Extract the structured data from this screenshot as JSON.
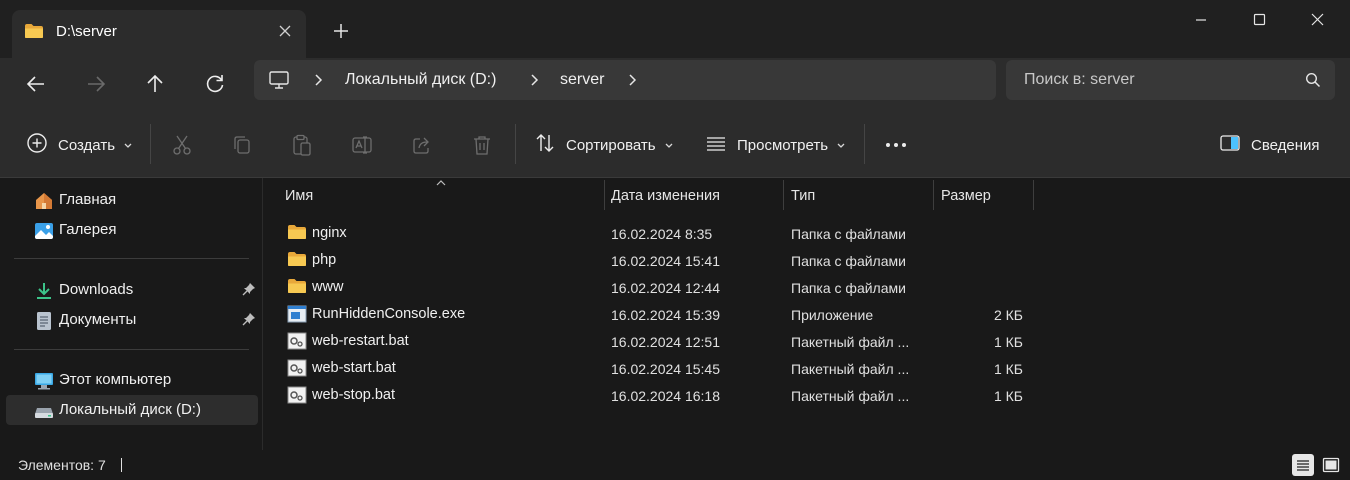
{
  "window": {
    "tab_title": "D:\\server",
    "icons": {
      "folder": "folder-icon",
      "close": "close-icon",
      "new_tab": "plus-icon",
      "minimize": "minimize-icon",
      "maximize": "maximize-icon",
      "window_close": "close-icon"
    }
  },
  "navigation": {
    "buttons": [
      "back-arrow-icon",
      "forward-arrow-icon",
      "up-arrow-icon",
      "refresh-icon"
    ],
    "breadcrumb": [
      "Локальный диск (D:)",
      "server"
    ],
    "search_placeholder": "Поиск в: server"
  },
  "commandbar": {
    "new_label": "Создать",
    "sort_label": "Сортировать",
    "view_label": "Просмотреть",
    "details_label": "Сведения",
    "icons": [
      "cut-icon",
      "copy-icon",
      "paste-icon",
      "rename-icon",
      "share-icon",
      "delete-icon",
      "more-icon"
    ]
  },
  "sidebar": {
    "items": [
      {
        "label": "Главная",
        "icon": "home-icon"
      },
      {
        "label": "Галерея",
        "icon": "gallery-icon"
      },
      {
        "label": "Downloads",
        "icon": "download-icon",
        "pinned": true
      },
      {
        "label": "Документы",
        "icon": "documents-icon",
        "pinned": true
      },
      {
        "label": "Этот компьютер",
        "icon": "computer-icon"
      },
      {
        "label": "Локальный диск (D:)",
        "icon": "drive-icon",
        "selected": true
      }
    ]
  },
  "filelist": {
    "columns": [
      "Имя",
      "Дата изменения",
      "Тип",
      "Размер"
    ],
    "sort_column": "Имя",
    "rows": [
      {
        "name": "nginx",
        "date": "16.02.2024 8:35",
        "type": "Папка с файлами",
        "size": "",
        "icon": "folder-icon"
      },
      {
        "name": "php",
        "date": "16.02.2024 15:41",
        "type": "Папка с файлами",
        "size": "",
        "icon": "folder-icon"
      },
      {
        "name": "www",
        "date": "16.02.2024 12:44",
        "type": "Папка с файлами",
        "size": "",
        "icon": "folder-icon"
      },
      {
        "name": "RunHiddenConsole.exe",
        "date": "16.02.2024 15:39",
        "type": "Приложение",
        "size": "2 КБ",
        "icon": "application-icon"
      },
      {
        "name": "web-restart.bat",
        "date": "16.02.2024 12:51",
        "type": "Пакетный файл ...",
        "size": "1 КБ",
        "icon": "batch-file-icon"
      },
      {
        "name": "web-start.bat",
        "date": "16.02.2024 15:45",
        "type": "Пакетный файл ...",
        "size": "1 КБ",
        "icon": "batch-file-icon"
      },
      {
        "name": "web-stop.bat",
        "date": "16.02.2024 16:18",
        "type": "Пакетный файл ...",
        "size": "1 КБ",
        "icon": "batch-file-icon"
      }
    ]
  },
  "statusbar": {
    "item_count": "Элементов: 7",
    "views": [
      "details-view-icon",
      "tiles-view-icon"
    ]
  },
  "colors": {
    "background": "#191919",
    "toolbar": "#2c2c2c",
    "folder": "#f2c14e",
    "accent": "#4cc2ff"
  }
}
